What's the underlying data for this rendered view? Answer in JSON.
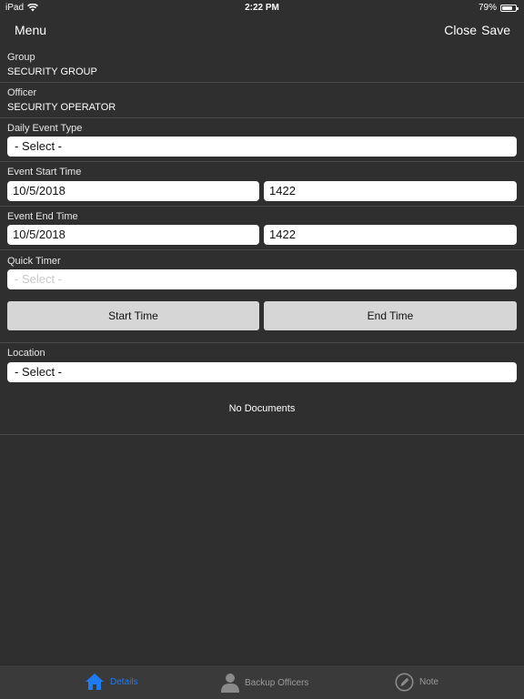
{
  "status": {
    "device": "iPad",
    "time": "2:22 PM",
    "battery": "79%"
  },
  "nav": {
    "menu": "Menu",
    "close": "Close",
    "save": "Save"
  },
  "group": {
    "label": "Group",
    "value": "SECURITY GROUP"
  },
  "officer": {
    "label": "Officer",
    "value": "SECURITY OPERATOR"
  },
  "daily_event_type": {
    "label": "Daily Event Type",
    "value": "- Select -"
  },
  "event_start": {
    "label": "Event Start Time",
    "date": "10/5/2018",
    "time": "1422"
  },
  "event_end": {
    "label": "Event End Time",
    "date": "10/5/2018",
    "time": "1422"
  },
  "quick_timer": {
    "label": "Quick Timer",
    "value": "- Select -"
  },
  "buttons": {
    "start_time": "Start Time",
    "end_time": "End Time"
  },
  "location": {
    "label": "Location",
    "value": "- Select -"
  },
  "documents": {
    "empty_text": "No Documents"
  },
  "tabs": [
    {
      "label": "Details",
      "icon": "home-icon",
      "active": true
    },
    {
      "label": "Backup Officers",
      "icon": "person-icon",
      "active": false
    },
    {
      "label": "Note",
      "icon": "pencil-icon",
      "active": false
    }
  ],
  "colors": {
    "background": "#2f2f2f",
    "accent": "#1f7bf2",
    "tabbar": "#3a3a3a"
  }
}
